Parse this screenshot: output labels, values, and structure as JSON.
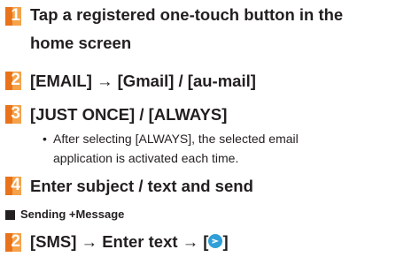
{
  "steps": [
    {
      "number": "1",
      "lines": [
        "Tap a registered one-touch button in the",
        "home screen"
      ]
    },
    {
      "number": "2",
      "text": "[EMAIL] → [Gmail] / [au-mail]"
    },
    {
      "number": "3",
      "text": "[JUST ONCE] / [ALWAYS]",
      "bullet": {
        "marker": "•",
        "lines": [
          "After selecting [ALWAYS], the selected email",
          "application is activated each time."
        ]
      }
    },
    {
      "number": "4",
      "text": "Enter subject / text and send"
    }
  ],
  "section": {
    "title": "Sending +Message"
  },
  "last_step": {
    "number": "2",
    "text_before": "[SMS] → Enter text → [",
    "icon": "send-icon",
    "text_after": "]"
  },
  "colors": {
    "badge_light": "#f5a24a",
    "badge_dark": "#e8731a",
    "icon_blue": "#2f9fd8",
    "text": "#231f20"
  }
}
